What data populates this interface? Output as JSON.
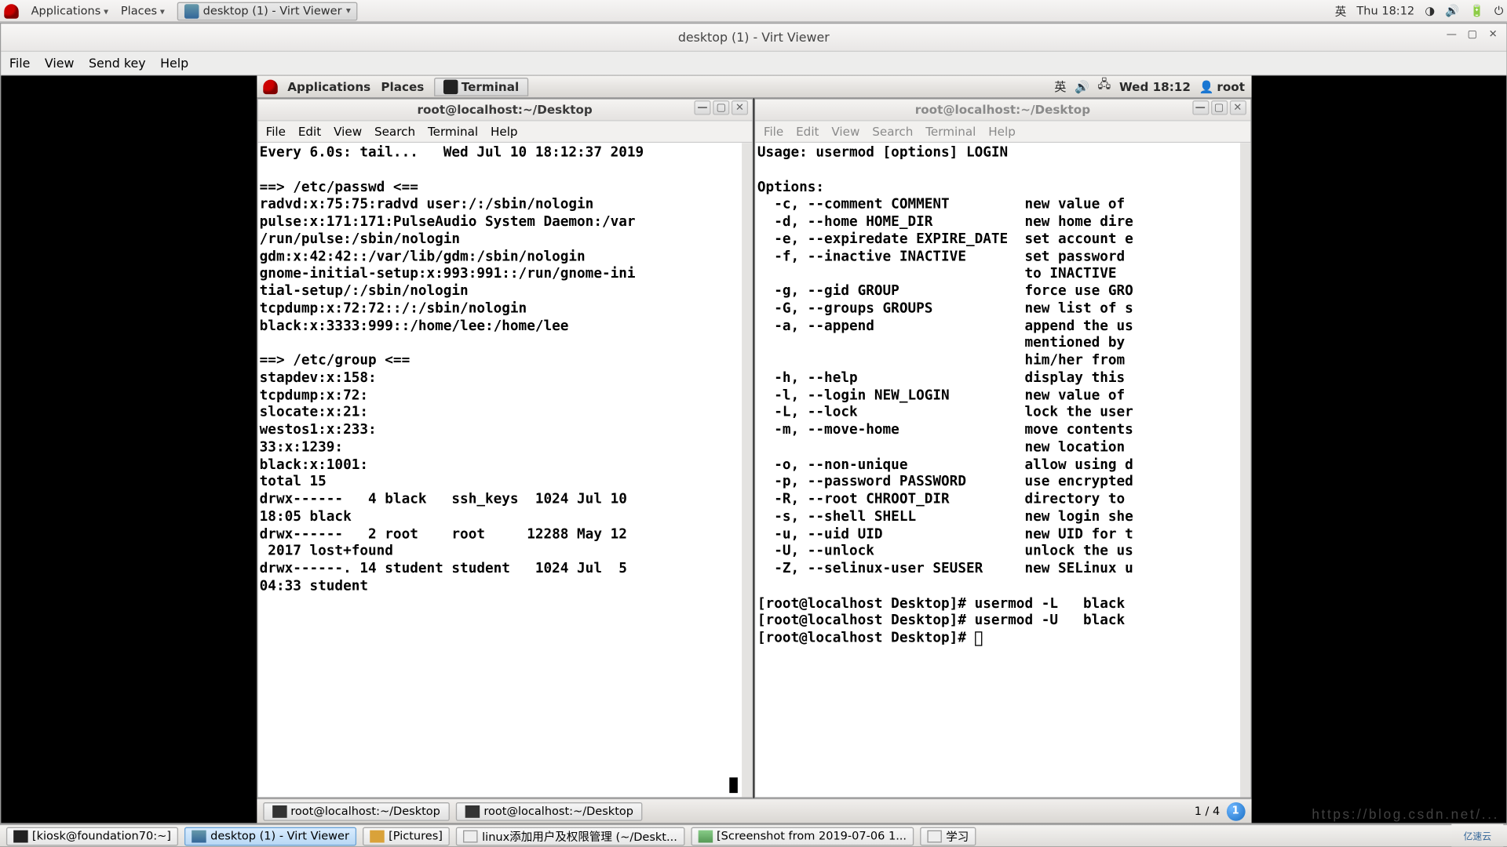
{
  "outer_top": {
    "applications": "Applications",
    "places": "Places",
    "active_app": "desktop (1) - Virt Viewer",
    "ime": "英",
    "clock": "Thu 18:12"
  },
  "virt": {
    "title": "desktop (1) - Virt Viewer",
    "menu": [
      "File",
      "View",
      "Send key",
      "Help"
    ]
  },
  "guest_top": {
    "applications": "Applications",
    "places": "Places",
    "terminal": "Terminal",
    "ime": "英",
    "clock": "Wed 18:12",
    "user": "root"
  },
  "term_left": {
    "title": "root@localhost:~/Desktop",
    "menu": [
      "File",
      "Edit",
      "View",
      "Search",
      "Terminal",
      "Help"
    ],
    "content": "Every 6.0s: tail...   Wed Jul 10 18:12:37 2019\n\n==> /etc/passwd <==\nradvd:x:75:75:radvd user:/:/sbin/nologin\npulse:x:171:171:PulseAudio System Daemon:/var\n/run/pulse:/sbin/nologin\ngdm:x:42:42::/var/lib/gdm:/sbin/nologin\ngnome-initial-setup:x:993:991::/run/gnome-ini\ntial-setup/:/sbin/nologin\ntcpdump:x:72:72::/:/sbin/nologin\nblack:x:3333:999::/home/lee:/home/lee\n\n==> /etc/group <==\nstapdev:x:158:\ntcpdump:x:72:\nslocate:x:21:\nwestos1:x:233:\n33:x:1239:\nblack:x:1001:\ntotal 15\ndrwx------   4 black   ssh_keys  1024 Jul 10\n18:05 black\ndrwx------   2 root    root     12288 May 12\n 2017 lost+found\ndrwx------. 14 student student   1024 Jul  5\n04:33 student"
  },
  "term_right": {
    "title": "root@localhost:~/Desktop",
    "menu": [
      "File",
      "Edit",
      "View",
      "Search",
      "Terminal",
      "Help"
    ],
    "content": "Usage: usermod [options] LOGIN\n\nOptions:\n  -c, --comment COMMENT         new value of \n  -d, --home HOME_DIR           new home dire\n  -e, --expiredate EXPIRE_DATE  set account e\n  -f, --inactive INACTIVE       set password \n                                to INACTIVE\n  -g, --gid GROUP               force use GRO\n  -G, --groups GROUPS           new list of s\n  -a, --append                  append the us\n                                mentioned by \n                                him/her from \n  -h, --help                    display this \n  -l, --login NEW_LOGIN         new value of \n  -L, --lock                    lock the user\n  -m, --move-home               move contents\n                                new location \n  -o, --non-unique              allow using d\n  -p, --password PASSWORD       use encrypted\n  -R, --root CHROOT_DIR         directory to \n  -s, --shell SHELL             new login she\n  -u, --uid UID                 new UID for t\n  -U, --unlock                  unlock the us\n  -Z, --selinux-user SEUSER     new SELinux u\n\n[root@localhost Desktop]# usermod -L   black\n[root@localhost Desktop]# usermod -U   black\n[root@localhost Desktop]# "
  },
  "guest_bottom": {
    "tasks": [
      "root@localhost:~/Desktop",
      "root@localhost:~/Desktop"
    ],
    "workspace": "1 / 4"
  },
  "outer_bottom": {
    "tasks": [
      "[kiosk@foundation70:~]",
      "desktop (1) - Virt Viewer",
      "[Pictures]",
      "linux添加用户及权限管理 (~/Deskt...",
      "[Screenshot from 2019-07-06 1...",
      "学习"
    ],
    "active_index": 1
  },
  "watermark": "https://blog.csdn.net/...",
  "cloud_brand": "亿速云"
}
